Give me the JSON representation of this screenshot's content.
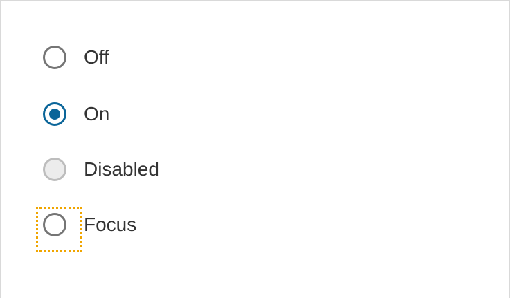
{
  "radios": [
    {
      "label": "Off",
      "state": "unchecked"
    },
    {
      "label": "On",
      "state": "checked"
    },
    {
      "label": "Disabled",
      "state": "disabled"
    },
    {
      "label": "Focus",
      "state": "focused"
    }
  ],
  "colors": {
    "checked": "#0a6599",
    "border": "#757575",
    "disabled_border": "#bdbdbd",
    "disabled_fill": "#ececec",
    "focus_ring": "#f0a500",
    "text": "#333333"
  }
}
